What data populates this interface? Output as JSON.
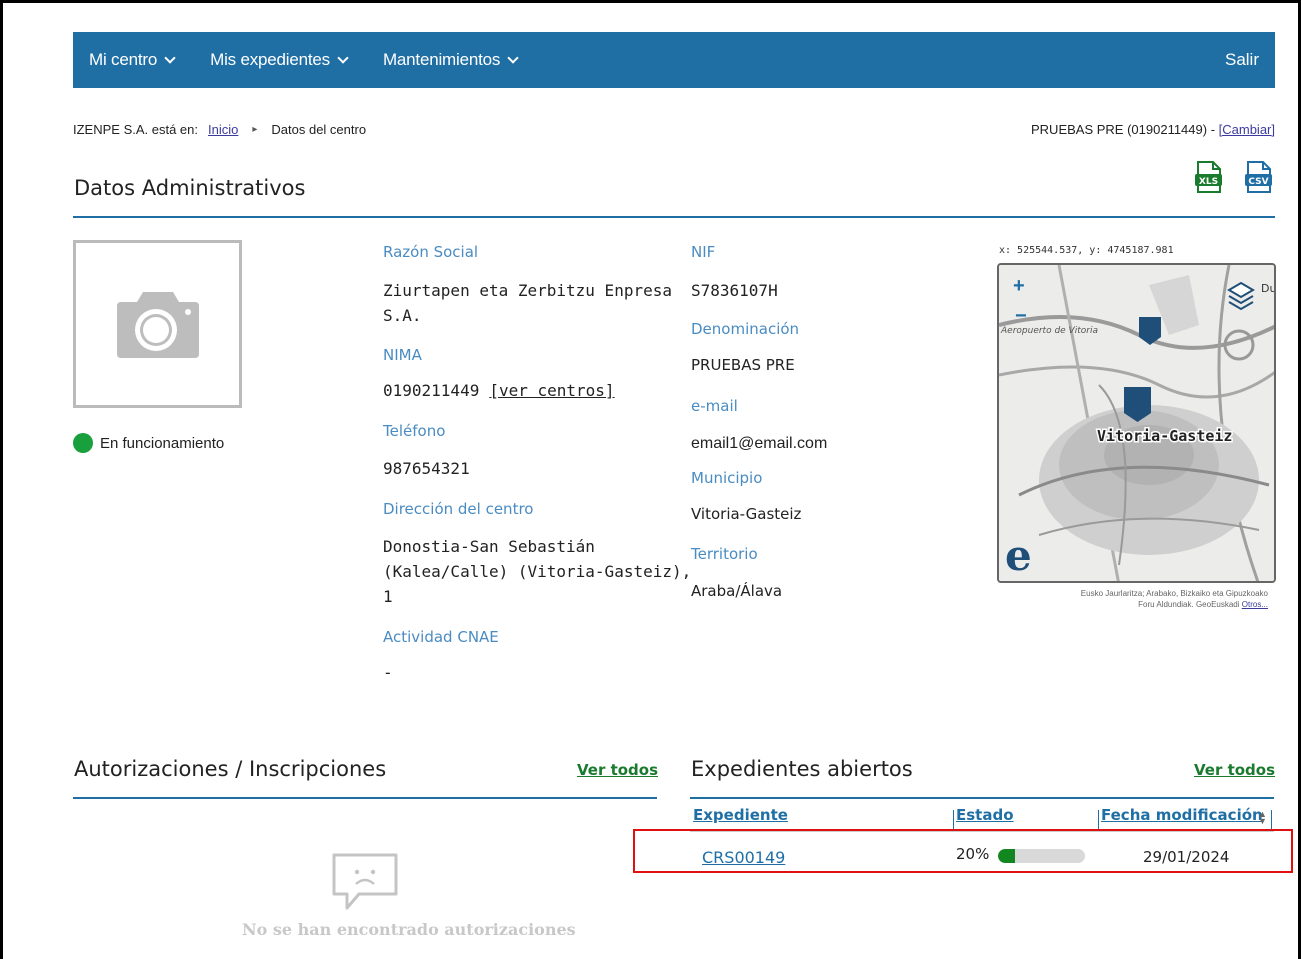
{
  "nav": {
    "items": [
      {
        "label": "Mi centro"
      },
      {
        "label": "Mis expedientes"
      },
      {
        "label": "Mantenimientos"
      }
    ],
    "logout_label": "Salir"
  },
  "breadcrumb": {
    "prefix": "IZENPE S.A. está en:",
    "home": "Inicio",
    "current": "Datos del centro"
  },
  "centre_selector": {
    "text": "PRUEBAS PRE (0190211449) - ",
    "change_label": "[Cambiar]"
  },
  "admin": {
    "title": "Datos Administrativos",
    "export_xls_label": "XLS",
    "export_csv_label": "CSV",
    "status": "En funcionamiento",
    "status_color": "#18a03c",
    "fields": {
      "razon_social_label": "Razón Social",
      "razon_social_line1": "Ziurtapen eta Zerbitzu Enpresa",
      "razon_social_line2": "S.A.",
      "nima_label": "NIMA",
      "nima_value": "0190211449",
      "nima_link": "[ver centros]",
      "telefono_label": "Teléfono",
      "telefono_value": "987654321",
      "direccion_label": "Dirección del centro",
      "direccion_line1": "Donostia-San Sebastián",
      "direccion_line2": "(Kalea/Calle) (Vitoria-Gasteiz),",
      "direccion_line3": "1",
      "actividad_label": "Actividad CNAE",
      "actividad_value": "-",
      "nif_label": "NIF",
      "nif_value": "S7836107H",
      "denominacion_label": "Denominación",
      "denominacion_value": "PRUEBAS PRE",
      "email_label": "e-mail",
      "email_value": "email1@email.com",
      "municipio_label": "Municipio",
      "municipio_value": "Vitoria-Gasteiz",
      "territorio_label": "Territorio",
      "territorio_value": "Araba/Álava"
    }
  },
  "map": {
    "coords": "x: 525544.537, y: 4745187.981",
    "city_label": "Vitoria-Gasteiz",
    "airport_label": "Aeropuerto de Vitoria",
    "corner_label": "Du",
    "zoom_in": "+",
    "zoom_out": "−",
    "logo": "e",
    "credits_line1": "Eusko Jaurlaritza; Arabako, Bizkaiko eta Gipuzkoako",
    "credits_line2": "Foru Aldundiak. GeoEuskadi ",
    "credits_link": "Otros..."
  },
  "autorizaciones": {
    "title": "Autorizaciones / Inscripciones",
    "ver_todos": "Ver todos",
    "empty_text": "No se han encontrado autorizaciones"
  },
  "expedientes": {
    "title": "Expedientes abiertos",
    "ver_todos": "Ver todos",
    "columns": [
      "Expediente",
      "Estado",
      "Fecha modificación"
    ],
    "rows": [
      {
        "expediente": "CRS00149",
        "estado_text": "20%",
        "estado_progress": 0.2,
        "fecha": "29/01/2024"
      }
    ]
  },
  "colors": {
    "primary": "#1f6fa5",
    "label_blue": "#4a8cc2",
    "link_green": "#1a7a2e",
    "highlight_red": "#e01010"
  }
}
